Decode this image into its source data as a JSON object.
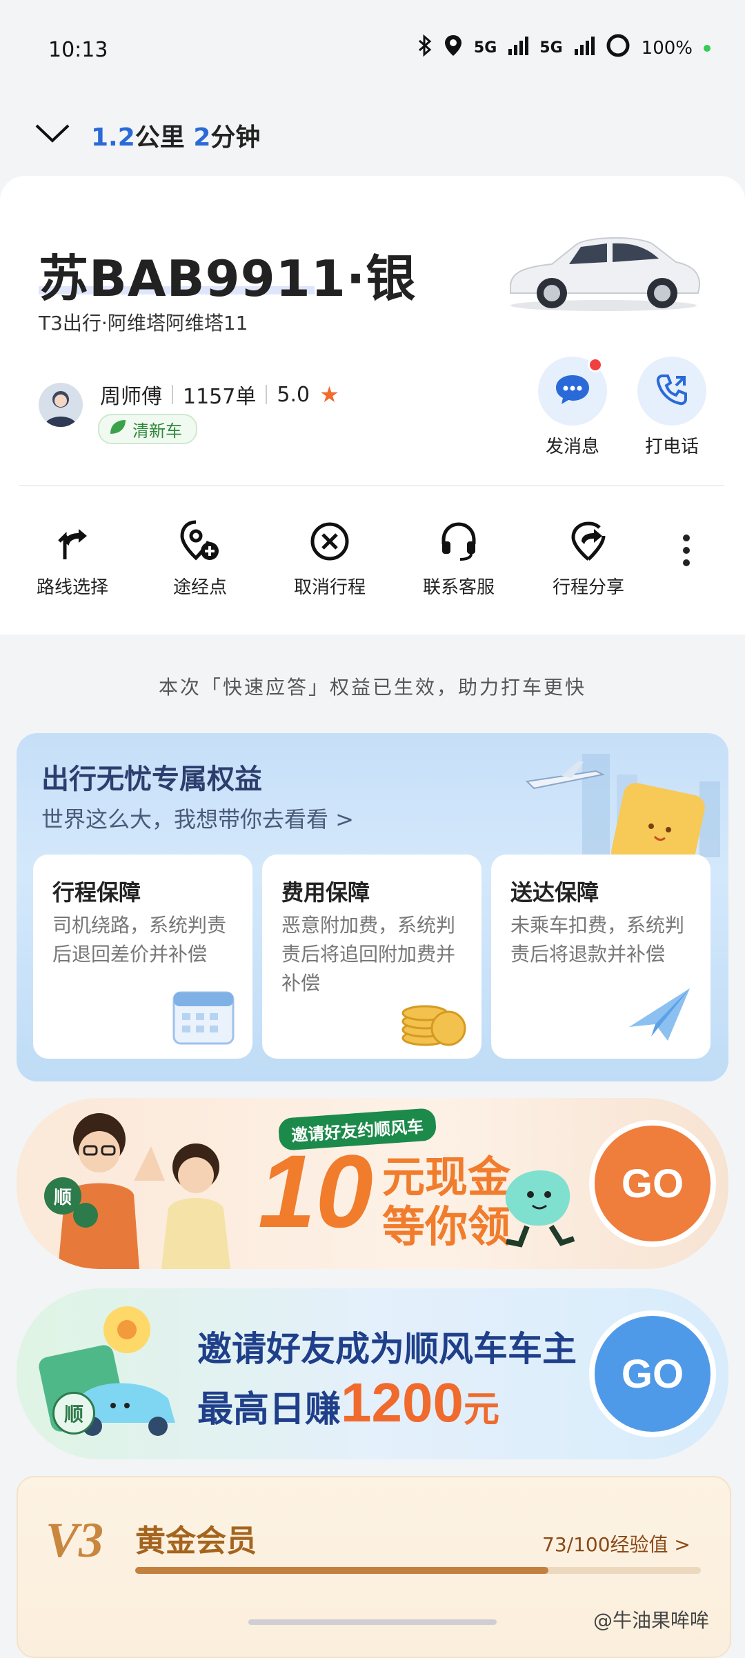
{
  "status_bar": {
    "time": "10:13",
    "network_1": "5G",
    "network_2": "5G",
    "battery": "100%"
  },
  "trip": {
    "distance_value": "1.2",
    "distance_unit": "公里",
    "time_value": "2",
    "time_unit": "分钟"
  },
  "vehicle": {
    "plate": "苏BAB9911·银",
    "company": "T3出行·阿维塔阿维塔11"
  },
  "driver": {
    "name": "周师傅",
    "orders": "1157单",
    "rating": "5.0",
    "badge": "清新车"
  },
  "contact": {
    "message_label": "发消息",
    "call_label": "打电话"
  },
  "actions": [
    {
      "label": "路线选择",
      "icon": "route-fork-icon"
    },
    {
      "label": "途经点",
      "icon": "waypoint-add-icon"
    },
    {
      "label": "取消行程",
      "icon": "cancel-circle-icon"
    },
    {
      "label": "联系客服",
      "icon": "headset-icon"
    },
    {
      "label": "行程分享",
      "icon": "share-location-icon"
    }
  ],
  "notice": "本次「快速应答」权益已生效，助力打车更快",
  "benefits": {
    "title": "出行无忧专属权益",
    "subtitle": "世界这么大，我想带你去看看 >",
    "cards": [
      {
        "title": "行程保障",
        "desc": "司机绕路，系统判责后退回差价并补偿"
      },
      {
        "title": "费用保障",
        "desc": "恶意附加费，系统判责后将追回附加费并补偿"
      },
      {
        "title": "送达保障",
        "desc": "未乘车扣费，系统判责后将退款并补偿"
      }
    ]
  },
  "promo1": {
    "tag": "邀请好友约顺风车",
    "big": "10",
    "line1": "元现金",
    "line2": "等你领",
    "badge": "顺",
    "go": "GO"
  },
  "promo2": {
    "line1": "邀请好友成为顺风车车主",
    "line2_prefix": "最高日赚",
    "amount": "1200",
    "line2_suffix": "元",
    "badge": "顺",
    "go": "GO"
  },
  "member": {
    "level": "V3",
    "title": "黄金会员",
    "exp": "73/100经验值 >",
    "progress": 0.73
  },
  "watermark": "@牛油果哞哞",
  "colors": {
    "accent_blue": "#2a6ad8",
    "star_orange": "#f26a2e",
    "go_orange": "#ef7d3c",
    "go_blue": "#4f9ae8"
  }
}
